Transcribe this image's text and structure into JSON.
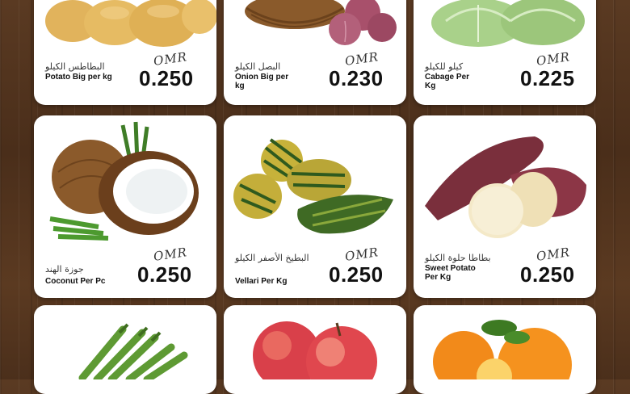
{
  "currency": "OMR",
  "products": [
    {
      "ar": "البطاطس الكيلو",
      "en": "Potato Big per kg",
      "price": "0.250"
    },
    {
      "ar": "البصل الكيلو",
      "en": "Onion Big per kg",
      "price": "0.230"
    },
    {
      "ar": "كيلو للكيلو",
      "en": "Cabage Per Kg",
      "price": "0.225"
    },
    {
      "ar": "جوزة الهند",
      "en": "Coconut Per Pc",
      "price": "0.250"
    },
    {
      "ar": "البطيخ الأصفر الكيلو",
      "en": "Vellari Per Kg",
      "price": "0.250"
    },
    {
      "ar": "بطاطا حلوة الكيلو",
      "en": "Sweet Potato Per Kg",
      "price": "0.250"
    }
  ],
  "bottom_row": [
    {
      "item": "okra-image"
    },
    {
      "item": "apple-image"
    },
    {
      "item": "orange-image"
    }
  ]
}
